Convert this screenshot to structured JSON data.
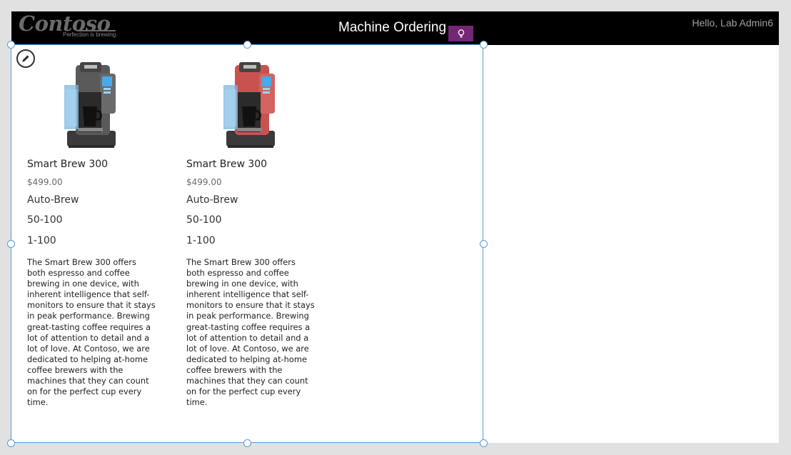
{
  "header": {
    "logo_text": "Contoso",
    "tagline": "Perfection is brewing.",
    "title": "Machine Ordering",
    "greeting": "Hello, Lab Admin6",
    "idea_icon": "lightbulb-icon",
    "idea_color": "#742774"
  },
  "gallery": {
    "edit_icon": "pencil-icon",
    "items": [
      {
        "name": "Smart Brew 300",
        "price": "$499.00",
        "spec1": "Auto-Brew",
        "spec2": "50-100",
        "spec3": "1-100",
        "color": "#5a5a5a",
        "description": "The Smart Brew 300 offers both espresso and coffee brewing in one device, with inherent intelligence that self-monitors to ensure that it stays in peak performance. Brewing great-tasting coffee requires a lot of attention to detail and a lot of love. At Contoso, we are dedicated to helping at-home coffee brewers with the machines that they can count on for the perfect cup every time."
      },
      {
        "name": "Smart Brew 300",
        "price": "$499.00",
        "spec1": "Auto-Brew",
        "spec2": "50-100",
        "spec3": "1-100",
        "color": "#c9524f",
        "description": "The Smart Brew 300 offers both espresso and coffee brewing in one device, with inherent intelligence that self-monitors to ensure that it stays in peak performance. Brewing great-tasting coffee requires a lot of attention to detail and a lot of love. At Contoso, we are dedicated to helping at-home coffee brewers with the machines that they can count on for the perfect cup every time."
      }
    ]
  }
}
